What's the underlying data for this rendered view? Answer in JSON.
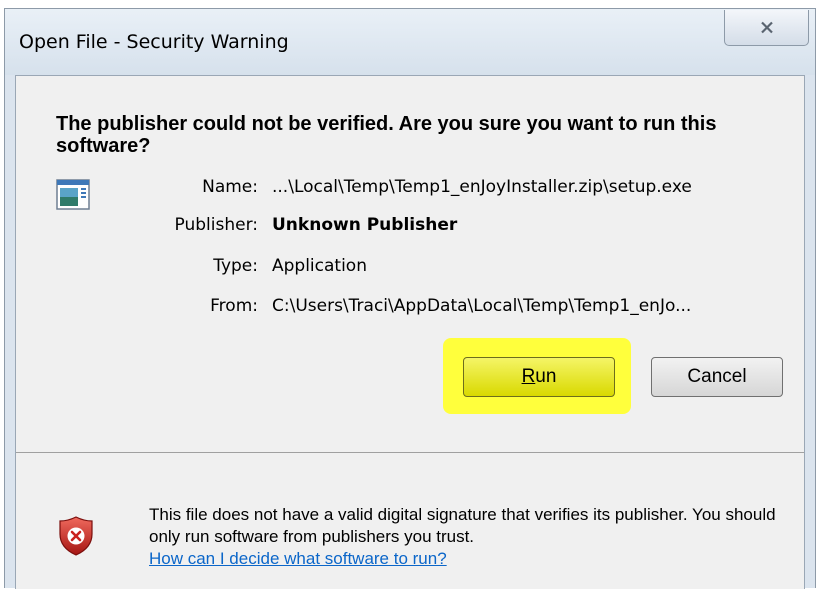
{
  "window": {
    "title": "Open File - Security Warning"
  },
  "dialog": {
    "headline": "The publisher could not be verified.  Are you sure you want to run this software?",
    "fields": [
      {
        "label": "Name:",
        "value": "...\\Local\\Temp\\Temp1_enJoyInstaller.zip\\setup.exe"
      },
      {
        "label": "Publisher:",
        "value": "Unknown Publisher"
      },
      {
        "label": "Type:",
        "value": "Application"
      },
      {
        "label": "From:",
        "value": "C:\\Users\\Traci\\AppData\\Local\\Temp\\Temp1_enJo..."
      }
    ],
    "run_label_access": "R",
    "run_label_rest": "un",
    "cancel_label": "Cancel"
  },
  "warning": {
    "text": "This file does not have a valid digital signature that verifies its publisher.  You should only run software from publishers you trust.",
    "link": "How can I decide what software to run?"
  },
  "icons": {
    "close": "close-icon",
    "app": "application-icon",
    "shield": "security-shield-icon"
  },
  "colors": {
    "highlight": "#ffff3c",
    "link": "#0b66c9",
    "shield_red": "#c9211e"
  }
}
